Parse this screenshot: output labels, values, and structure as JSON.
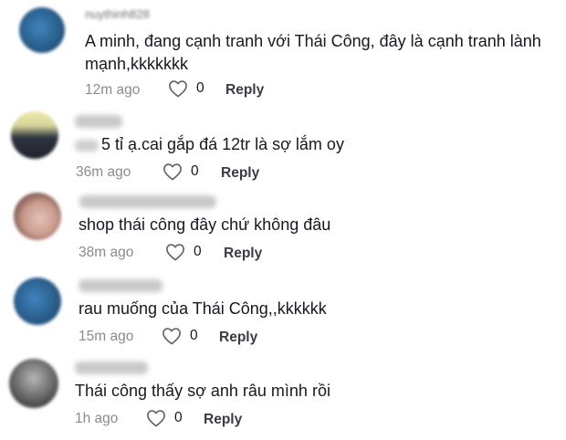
{
  "comments": [
    {
      "username": "nuythinh828",
      "text": "A minh, đang cạnh tranh với Thái Công, đây là cạnh tranh lành",
      "text_line2": "mạnh,kkkkkkk",
      "time": "12m ago",
      "likes": "0",
      "reply_label": "Reply",
      "avatar_colors": [
        "#4a90c8",
        "#2a5d8a"
      ]
    },
    {
      "text": "5 tỉ ạ.cai gắp đá 12tr là sợ lắm oy",
      "time": "36m ago",
      "likes": "0",
      "reply_label": "Reply",
      "avatar_colors": [
        "#e8e7a2",
        "#2c2f3a"
      ]
    },
    {
      "text": "shop thái công đây chứ không đâu",
      "time": "38m ago",
      "likes": "0",
      "reply_label": "Reply",
      "avatar_colors": [
        "#d8b4a8",
        "#5a3b35"
      ]
    },
    {
      "text": "rau muống của Thái Công,,kkkkkk",
      "time": "15m ago",
      "likes": "0",
      "reply_label": "Reply",
      "avatar_colors": [
        "#4a90c8",
        "#2a5d8a"
      ]
    },
    {
      "text": "Thái công thấy sợ anh râu mình rồi",
      "time": "1h ago",
      "likes": "0",
      "reply_label": "Reply",
      "avatar_colors": [
        "#9a9a9a",
        "#3d3d3d"
      ]
    }
  ]
}
